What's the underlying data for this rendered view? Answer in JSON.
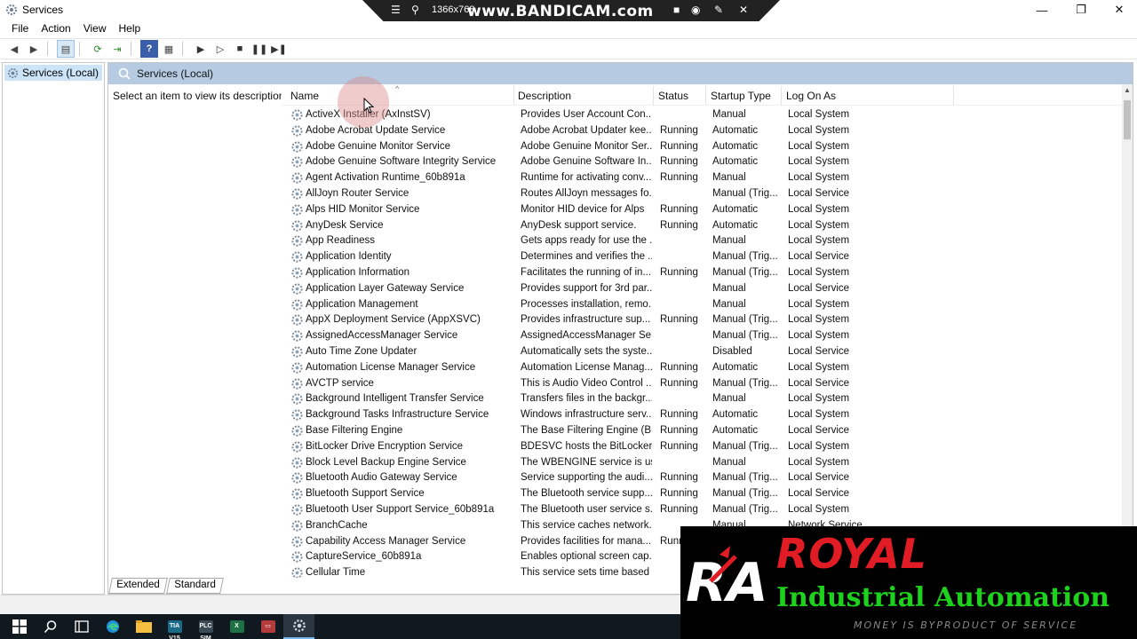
{
  "window": {
    "title": "Services",
    "controls": {
      "minimize": "—",
      "maximize": "❐",
      "close": "✕"
    }
  },
  "overlay": {
    "resolution": "1366x768",
    "brand": "www.BANDICAM.com"
  },
  "menu": [
    "File",
    "Action",
    "View",
    "Help"
  ],
  "tree": {
    "root": "Services (Local)"
  },
  "pane": {
    "header": "Services (Local)",
    "description_prompt": "Select an item to view its description."
  },
  "columns": {
    "name": "Name",
    "description": "Description",
    "status": "Status",
    "startup": "Startup Type",
    "logon": "Log On As"
  },
  "services": [
    {
      "name": "ActiveX Installer (AxInstSV)",
      "desc": "Provides User Account Con...",
      "status": "",
      "startup": "Manual",
      "logon": "Local System"
    },
    {
      "name": "Adobe Acrobat Update Service",
      "desc": "Adobe Acrobat Updater kee...",
      "status": "Running",
      "startup": "Automatic",
      "logon": "Local System"
    },
    {
      "name": "Adobe Genuine Monitor Service",
      "desc": "Adobe Genuine Monitor Ser...",
      "status": "Running",
      "startup": "Automatic",
      "logon": "Local System"
    },
    {
      "name": "Adobe Genuine Software Integrity Service",
      "desc": "Adobe Genuine Software In...",
      "status": "Running",
      "startup": "Automatic",
      "logon": "Local System"
    },
    {
      "name": "Agent Activation Runtime_60b891a",
      "desc": "Runtime for activating conv...",
      "status": "Running",
      "startup": "Manual",
      "logon": "Local System"
    },
    {
      "name": "AllJoyn Router Service",
      "desc": "Routes AllJoyn messages fo...",
      "status": "",
      "startup": "Manual (Trig...",
      "logon": "Local Service"
    },
    {
      "name": "Alps HID Monitor Service",
      "desc": "Monitor HID device for Alps",
      "status": "Running",
      "startup": "Automatic",
      "logon": "Local System"
    },
    {
      "name": "AnyDesk Service",
      "desc": "AnyDesk support service.",
      "status": "Running",
      "startup": "Automatic",
      "logon": "Local System"
    },
    {
      "name": "App Readiness",
      "desc": "Gets apps ready for use the ...",
      "status": "",
      "startup": "Manual",
      "logon": "Local System"
    },
    {
      "name": "Application Identity",
      "desc": "Determines and verifies the ...",
      "status": "",
      "startup": "Manual (Trig...",
      "logon": "Local Service"
    },
    {
      "name": "Application Information",
      "desc": "Facilitates the running of in...",
      "status": "Running",
      "startup": "Manual (Trig...",
      "logon": "Local System"
    },
    {
      "name": "Application Layer Gateway Service",
      "desc": "Provides support for 3rd par...",
      "status": "",
      "startup": "Manual",
      "logon": "Local Service"
    },
    {
      "name": "Application Management",
      "desc": "Processes installation, remo...",
      "status": "",
      "startup": "Manual",
      "logon": "Local System"
    },
    {
      "name": "AppX Deployment Service (AppXSVC)",
      "desc": "Provides infrastructure sup...",
      "status": "Running",
      "startup": "Manual (Trig...",
      "logon": "Local System"
    },
    {
      "name": "AssignedAccessManager Service",
      "desc": "AssignedAccessManager Se...",
      "status": "",
      "startup": "Manual (Trig...",
      "logon": "Local System"
    },
    {
      "name": "Auto Time Zone Updater",
      "desc": "Automatically sets the syste...",
      "status": "",
      "startup": "Disabled",
      "logon": "Local Service"
    },
    {
      "name": "Automation License Manager Service",
      "desc": "Automation License Manag...",
      "status": "Running",
      "startup": "Automatic",
      "logon": "Local System"
    },
    {
      "name": "AVCTP service",
      "desc": "This is Audio Video Control ...",
      "status": "Running",
      "startup": "Manual (Trig...",
      "logon": "Local Service"
    },
    {
      "name": "Background Intelligent Transfer Service",
      "desc": "Transfers files in the backgr...",
      "status": "",
      "startup": "Manual",
      "logon": "Local System"
    },
    {
      "name": "Background Tasks Infrastructure Service",
      "desc": "Windows infrastructure serv...",
      "status": "Running",
      "startup": "Automatic",
      "logon": "Local System"
    },
    {
      "name": "Base Filtering Engine",
      "desc": "The Base Filtering Engine (B...",
      "status": "Running",
      "startup": "Automatic",
      "logon": "Local Service"
    },
    {
      "name": "BitLocker Drive Encryption Service",
      "desc": "BDESVC hosts the BitLocker...",
      "status": "Running",
      "startup": "Manual (Trig...",
      "logon": "Local System"
    },
    {
      "name": "Block Level Backup Engine Service",
      "desc": "The WBENGINE service is us...",
      "status": "",
      "startup": "Manual",
      "logon": "Local System"
    },
    {
      "name": "Bluetooth Audio Gateway Service",
      "desc": "Service supporting the audi...",
      "status": "Running",
      "startup": "Manual (Trig...",
      "logon": "Local Service"
    },
    {
      "name": "Bluetooth Support Service",
      "desc": "The Bluetooth service supp...",
      "status": "Running",
      "startup": "Manual (Trig...",
      "logon": "Local Service"
    },
    {
      "name": "Bluetooth User Support Service_60b891a",
      "desc": "The Bluetooth user service s...",
      "status": "Running",
      "startup": "Manual (Trig...",
      "logon": "Local System"
    },
    {
      "name": "BranchCache",
      "desc": "This service caches network...",
      "status": "",
      "startup": "Manual",
      "logon": "Network Service"
    },
    {
      "name": "Capability Access Manager Service",
      "desc": "Provides facilities for mana...",
      "status": "Runn",
      "startup": "",
      "logon": ""
    },
    {
      "name": "CaptureService_60b891a",
      "desc": "Enables optional screen cap...",
      "status": "",
      "startup": "",
      "logon": ""
    },
    {
      "name": "Cellular Time",
      "desc": "This service sets time based ...",
      "status": "",
      "startup": "",
      "logon": ""
    }
  ],
  "tabs": [
    "Extended",
    "Standard"
  ],
  "taskbar": {
    "items": [
      "windows-start",
      "search",
      "task-view",
      "edge",
      "file-explorer",
      "TIA V15",
      "PLC SIM",
      "excel",
      "tool",
      "services"
    ],
    "tia_label": "TIA V15",
    "plcsim_label": "PLC SIM"
  },
  "watermark": {
    "logo_letters": "RA",
    "title": "ROYAL",
    "subtitle": "Industrial Automation",
    "tagline": "MONEY IS BYPRODUCT OF SERVICE"
  },
  "colors": {
    "pane_header": "#b6cbe2",
    "selection": "#cce4f7",
    "watermark_red": "#e21c25",
    "watermark_green": "#1dd11d",
    "taskbar": "#101820"
  }
}
